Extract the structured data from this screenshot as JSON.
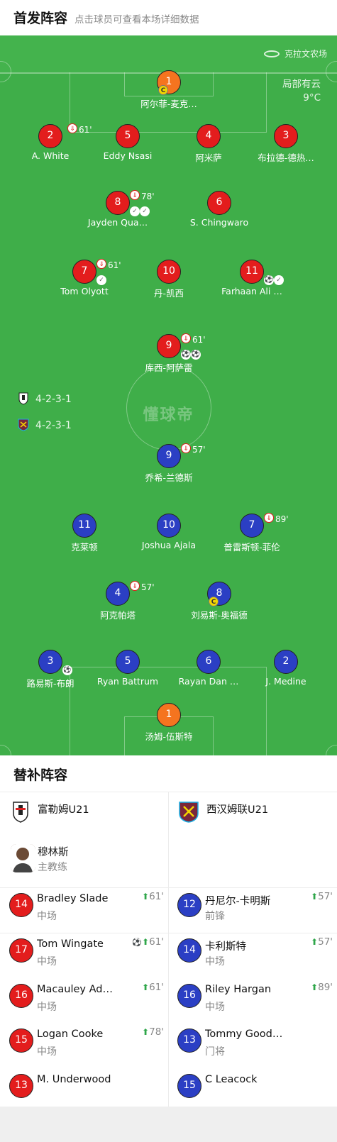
{
  "header": {
    "title": "首发阵容",
    "subtitle": "点击球员可查看本场详细数据"
  },
  "venue": "克拉文农场",
  "weather": {
    "desc": "局部有云",
    "temp": "9°C"
  },
  "watermark": "懂球帝",
  "home_formation": "4-2-3-1",
  "away_formation": "4-2-3-1",
  "home_lineup": [
    {
      "num": "1",
      "name": "阿尔菲-麦克…",
      "cls": "gk"
    },
    {
      "num": "2",
      "name": "A. White",
      "sub": "61'"
    },
    {
      "num": "5",
      "name": "Eddy Nsasi"
    },
    {
      "num": "4",
      "name": "阿米萨"
    },
    {
      "num": "3",
      "name": "布拉德-德热…"
    },
    {
      "num": "8",
      "name": "Jayden Qua…",
      "sub": "78'"
    },
    {
      "num": "6",
      "name": "S. Chingwaro"
    },
    {
      "num": "7",
      "name": "Tom Olyott",
      "sub": "61'"
    },
    {
      "num": "10",
      "name": "丹-凯西"
    },
    {
      "num": "11",
      "name": "Farhaan Ali …"
    },
    {
      "num": "9",
      "name": "库西-阿萨雷",
      "sub": "61'"
    }
  ],
  "away_lineup": [
    {
      "num": "9",
      "name": "乔希-兰德斯",
      "sub": "57'"
    },
    {
      "num": "11",
      "name": "克莱顿"
    },
    {
      "num": "10",
      "name": "Joshua Ajala"
    },
    {
      "num": "7",
      "name": "普雷斯顿-菲伦",
      "sub": "89'"
    },
    {
      "num": "4",
      "name": "阿克帕塔",
      "sub": "57'"
    },
    {
      "num": "8",
      "name": "刘易斯-奥福德"
    },
    {
      "num": "3",
      "name": "路易斯-布朗"
    },
    {
      "num": "5",
      "name": "Ryan Battrum"
    },
    {
      "num": "6",
      "name": "Rayan Dan …"
    },
    {
      "num": "2",
      "name": "J. Medine"
    },
    {
      "num": "1",
      "name": "汤姆-伍斯特",
      "cls": "gk"
    }
  ],
  "subs": {
    "title": "替补阵容",
    "home_team": "富勒姆U21",
    "away_team": "西汉姆联U21",
    "coach": {
      "name": "穆林斯",
      "role": "主教练"
    },
    "home": [
      {
        "num": "14",
        "name": "Bradley Slade",
        "pos": "中场",
        "time": "61'"
      },
      {
        "num": "17",
        "name": "Tom Wingate",
        "pos": "中场",
        "time": "61'",
        "goal": true
      },
      {
        "num": "16",
        "name": "Macauley Ad…",
        "pos": "中场",
        "time": "61'"
      },
      {
        "num": "15",
        "name": "Logan Cooke",
        "pos": "中场",
        "time": "78'"
      },
      {
        "num": "13",
        "name": "M. Underwood",
        "pos": "",
        "time": ""
      }
    ],
    "away": [
      {
        "num": "12",
        "name": "丹尼尔-卡明斯",
        "pos": "前锋",
        "time": "57'"
      },
      {
        "num": "14",
        "name": "卡利斯特",
        "pos": "中场",
        "time": "57'"
      },
      {
        "num": "16",
        "name": "Riley Hargan",
        "pos": "中场",
        "time": "89'"
      },
      {
        "num": "13",
        "name": "Tommy Good…",
        "pos": "门将",
        "time": ""
      },
      {
        "num": "15",
        "name": "C Leacock",
        "pos": "",
        "time": ""
      }
    ]
  },
  "colors": {
    "pitch": "#3fae49",
    "home": "#e31d1d",
    "away": "#2b3fc4",
    "gk": "#f5741f",
    "sub_in": "#2fa64a"
  }
}
